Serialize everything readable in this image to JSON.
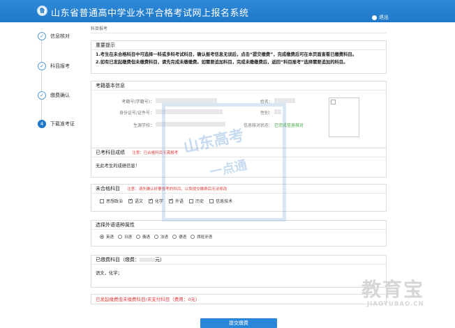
{
  "header": {
    "logo_glyph": "鲁",
    "title": "山东省普通高中学业水平合格考试网上报名系统",
    "logout": "退出"
  },
  "steps": [
    {
      "label": "信息核对",
      "state": "done",
      "glyph": "✓"
    },
    {
      "label": "科目报考",
      "state": "done",
      "glyph": "✓"
    },
    {
      "label": "缴费确认",
      "state": "done",
      "glyph": "✓"
    },
    {
      "label": "下载准考证",
      "state": "current",
      "glyph": "4"
    }
  ],
  "breadcrumb": "科目报考",
  "notice": {
    "title": "重要提示",
    "lines": [
      "1.考生在未合格科目中可选择一科或多科考试科目，确认报考信息无误后，点击“提交缴费”，完成缴费后可在本页面查看已缴费科目。",
      "2.如有已发起缴费但未缴费科目，请先完成未缴缴费。如需要追加科目，完成未缴缴费后，返回“科目报考”选择需要追加的科目。"
    ]
  },
  "basic_info": {
    "title": "考籍基本信息",
    "exam_no_label": "考籍号(学籍号)：",
    "name_label": "姓名：",
    "id_label": "身份证号/证件号：",
    "gender_label": "性别：",
    "school_label": "生源学校：",
    "status_label": "信息核对状态：",
    "status_value": "已完成信息核对"
  },
  "taken": {
    "title": "已考科目成绩",
    "note": "注意：已合格科目无需报考",
    "content": "无此考生的成绩信息！"
  },
  "failed": {
    "title": "未合格科目",
    "note": "注意：请先确认好要报考的科目，以免提交缴费后无法修改",
    "subjects": [
      {
        "label": "思想政治",
        "checked": false
      },
      {
        "label": "语文",
        "checked": true
      },
      {
        "label": "化学",
        "checked": true
      },
      {
        "label": "外语",
        "checked": true
      },
      {
        "label": "历史",
        "checked": false
      },
      {
        "label": "信息技术",
        "checked": false
      }
    ]
  },
  "language": {
    "title": "选择外语语种属性",
    "options": [
      {
        "label": "英语",
        "selected": true
      },
      {
        "label": "日语",
        "selected": false
      },
      {
        "label": "俄语",
        "selected": false
      },
      {
        "label": "法语",
        "selected": false
      },
      {
        "label": "德语",
        "selected": false
      },
      {
        "label": "西班牙语",
        "selected": false
      }
    ]
  },
  "paid": {
    "title_prefix": "已缴费科目（缴费：",
    "title_suffix": "元）",
    "content": "语文，化学；"
  },
  "unpaid": {
    "text": "已发起缴费但未缴费科目/未支付科目（费用：0元）"
  },
  "submit_label": "提交缴费",
  "watermark": {
    "line1": "山东高考",
    "line2": "一点通",
    "brand": "教育宝",
    "url": "JIAOYUBAO.CN"
  }
}
